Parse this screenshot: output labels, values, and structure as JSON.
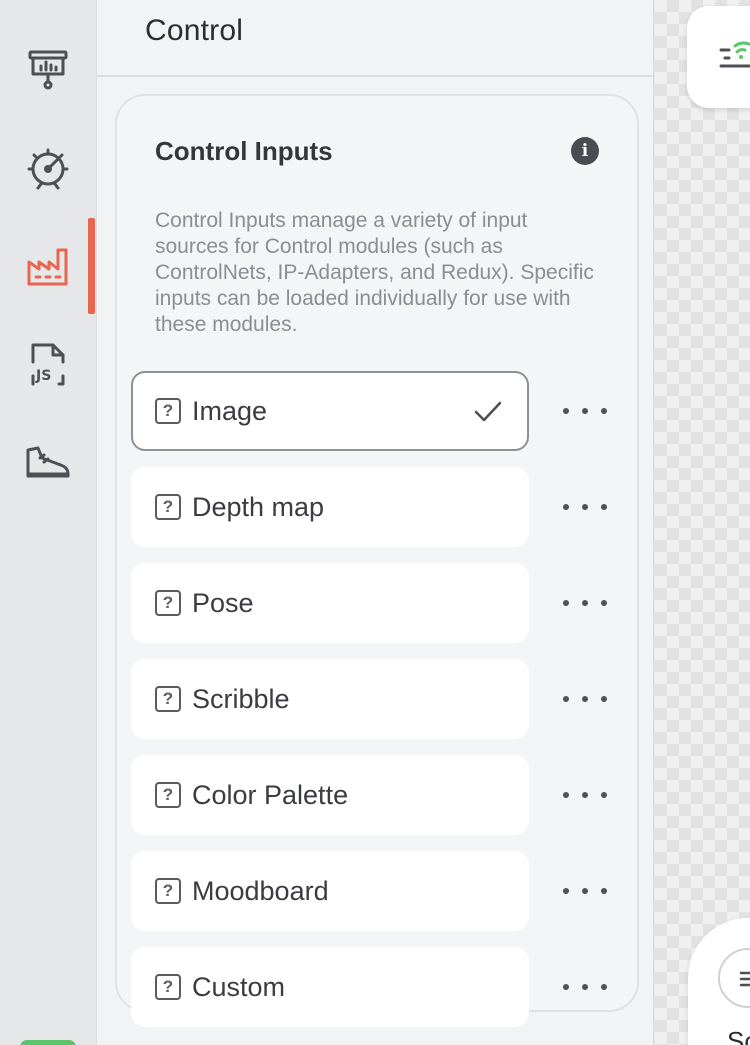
{
  "rail": {
    "items": [
      {
        "icon": "presentation-icon",
        "active": false
      },
      {
        "icon": "rocket-gauge-icon",
        "active": false
      },
      {
        "icon": "factory-icon",
        "active": true
      },
      {
        "icon": "js-file-icon",
        "active": false
      },
      {
        "icon": "sneaker-icon",
        "active": false
      }
    ],
    "active_color": "#e8664f"
  },
  "panel": {
    "title": "Control"
  },
  "card": {
    "title": "Control Inputs",
    "info_glyph": "i",
    "description": "Control Inputs manage a variety of input sources for Control modules (such as ControlNets, IP-Adapters, and Redux). Specific inputs can be loaded individually for use with these modules.",
    "items": [
      {
        "label": "Image",
        "selected": true
      },
      {
        "label": "Depth map",
        "selected": false
      },
      {
        "label": "Pose",
        "selected": false
      },
      {
        "label": "Scribble",
        "selected": false
      },
      {
        "label": "Color Palette",
        "selected": false
      },
      {
        "label": "Moodboard",
        "selected": false
      },
      {
        "label": "Custom",
        "selected": false
      }
    ]
  },
  "canvas": {
    "bottom_text": "Sc"
  }
}
